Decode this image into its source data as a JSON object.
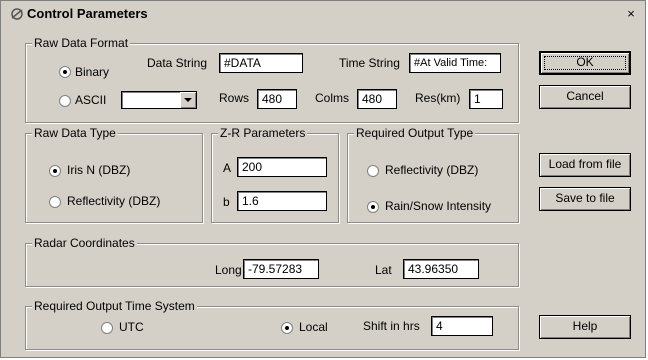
{
  "window": {
    "title": "Control Parameters",
    "close_glyph": "×"
  },
  "raw_data_format": {
    "legend": "Raw Data Format",
    "binary_label": "Binary",
    "ascii_label": "ASCII",
    "selected": "Binary",
    "format_select_value": "",
    "data_string_label": "Data String",
    "data_string_value": "#DATA",
    "time_string_label": "Time String",
    "time_string_value": "#At Valid Time:",
    "rows_label": "Rows",
    "rows_value": "480",
    "colms_label": "Colms",
    "colms_value": "480",
    "res_label": "Res(km)",
    "res_value": "1"
  },
  "raw_data_type": {
    "legend": "Raw Data Type",
    "option1": "Iris N (DBZ)",
    "option2": "Reflectivity (DBZ)",
    "selected": "Iris N (DBZ)"
  },
  "zr_parameters": {
    "legend": "Z-R Parameters",
    "a_label": "A",
    "a_value": "200",
    "b_label": "b",
    "b_value": "1.6"
  },
  "required_output_type": {
    "legend": "Required Output Type",
    "option1": "Reflectivity (DBZ)",
    "option2": "Rain/Snow Intensity",
    "selected": "Rain/Snow Intensity"
  },
  "radar_coordinates": {
    "legend": "Radar Coordinates",
    "long_label": "Long",
    "long_value": "-79.57283",
    "lat_label": "Lat",
    "lat_value": "43.96350"
  },
  "output_time_system": {
    "legend": "Required Output Time System",
    "utc_label": "UTC",
    "local_label": "Local",
    "selected": "Local",
    "shift_label": "Shift in hrs",
    "shift_value": "4"
  },
  "buttons": {
    "ok": "OK",
    "cancel": "Cancel",
    "load": "Load from file",
    "save": "Save to file",
    "help": "Help"
  }
}
